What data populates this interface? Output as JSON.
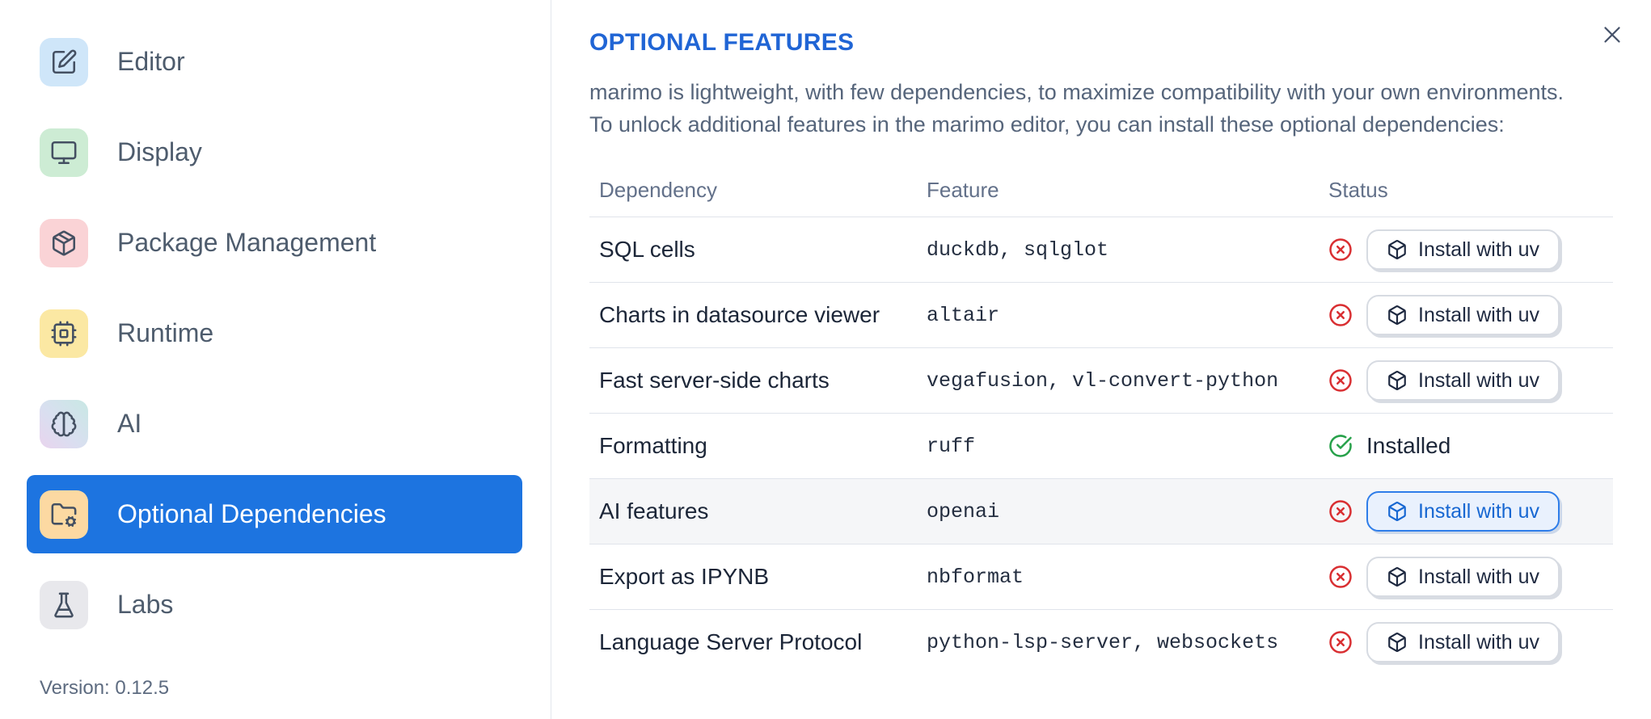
{
  "sidebar": {
    "items": [
      {
        "label": "Editor",
        "icon": "edit-icon",
        "icon_bg": "#cfe6f9",
        "selected": false
      },
      {
        "label": "Display",
        "icon": "monitor-icon",
        "icon_bg": "#cdecd4",
        "selected": false
      },
      {
        "label": "Package Management",
        "icon": "package-icon",
        "icon_bg": "#fad3d6",
        "selected": false
      },
      {
        "label": "Runtime",
        "icon": "cpu-icon",
        "icon_bg": "#fbe8a3",
        "selected": false
      },
      {
        "label": "AI",
        "icon": "brain-icon",
        "icon_bg": "linear-gradient(225deg,#c8e8e4 0%,#d9dff0 55%,#e9d4ee 100%)",
        "selected": false
      },
      {
        "label": "Optional Dependencies",
        "icon": "folder-cog-icon",
        "icon_bg": "#fcd9a2",
        "selected": true
      },
      {
        "label": "Labs",
        "icon": "flask-icon",
        "icon_bg": "#e8e8ec",
        "selected": false
      }
    ],
    "version": "Version: 0.12.5"
  },
  "panel": {
    "title": "OPTIONAL FEATURES",
    "description_line1": "marimo is lightweight, with few dependencies, to maximize compatibility with your own environments.",
    "description_line2": "To unlock additional features in the marimo editor, you can install these optional dependencies:",
    "close_icon": "close-icon"
  },
  "table": {
    "headers": [
      "Dependency",
      "Feature",
      "Status"
    ],
    "rows": [
      {
        "dependency": "SQL cells",
        "feature": "duckdb, sqlglot",
        "installed": false,
        "action_label": "Install with uv",
        "highlighted": false,
        "focused": false
      },
      {
        "dependency": "Charts in datasource viewer",
        "feature": "altair",
        "installed": false,
        "action_label": "Install with uv",
        "highlighted": false,
        "focused": false
      },
      {
        "dependency": "Fast server-side charts",
        "feature": "vegafusion, vl-convert-python",
        "installed": false,
        "action_label": "Install with uv",
        "highlighted": false,
        "focused": false
      },
      {
        "dependency": "Formatting",
        "feature": "ruff",
        "installed": true,
        "status_text": "Installed",
        "highlighted": false,
        "focused": false
      },
      {
        "dependency": "AI features",
        "feature": "openai",
        "installed": false,
        "action_label": "Install with uv",
        "highlighted": true,
        "focused": true
      },
      {
        "dependency": "Export as IPYNB",
        "feature": "nbformat",
        "installed": false,
        "action_label": "Install with uv",
        "highlighted": false,
        "focused": false
      },
      {
        "dependency": "Language Server Protocol",
        "feature": "python-lsp-server, websockets",
        "installed": false,
        "action_label": "Install with uv",
        "highlighted": false,
        "focused": false
      }
    ]
  },
  "colors": {
    "selected_nav_bg": "#1d74e0",
    "title_blue": "#2065d5",
    "error_red": "#d92f32",
    "success_green": "#27a14a",
    "focused_button_border": "#2e7de9",
    "focused_button_bg": "#e9f1fd",
    "divider": "#e0e4eb"
  }
}
